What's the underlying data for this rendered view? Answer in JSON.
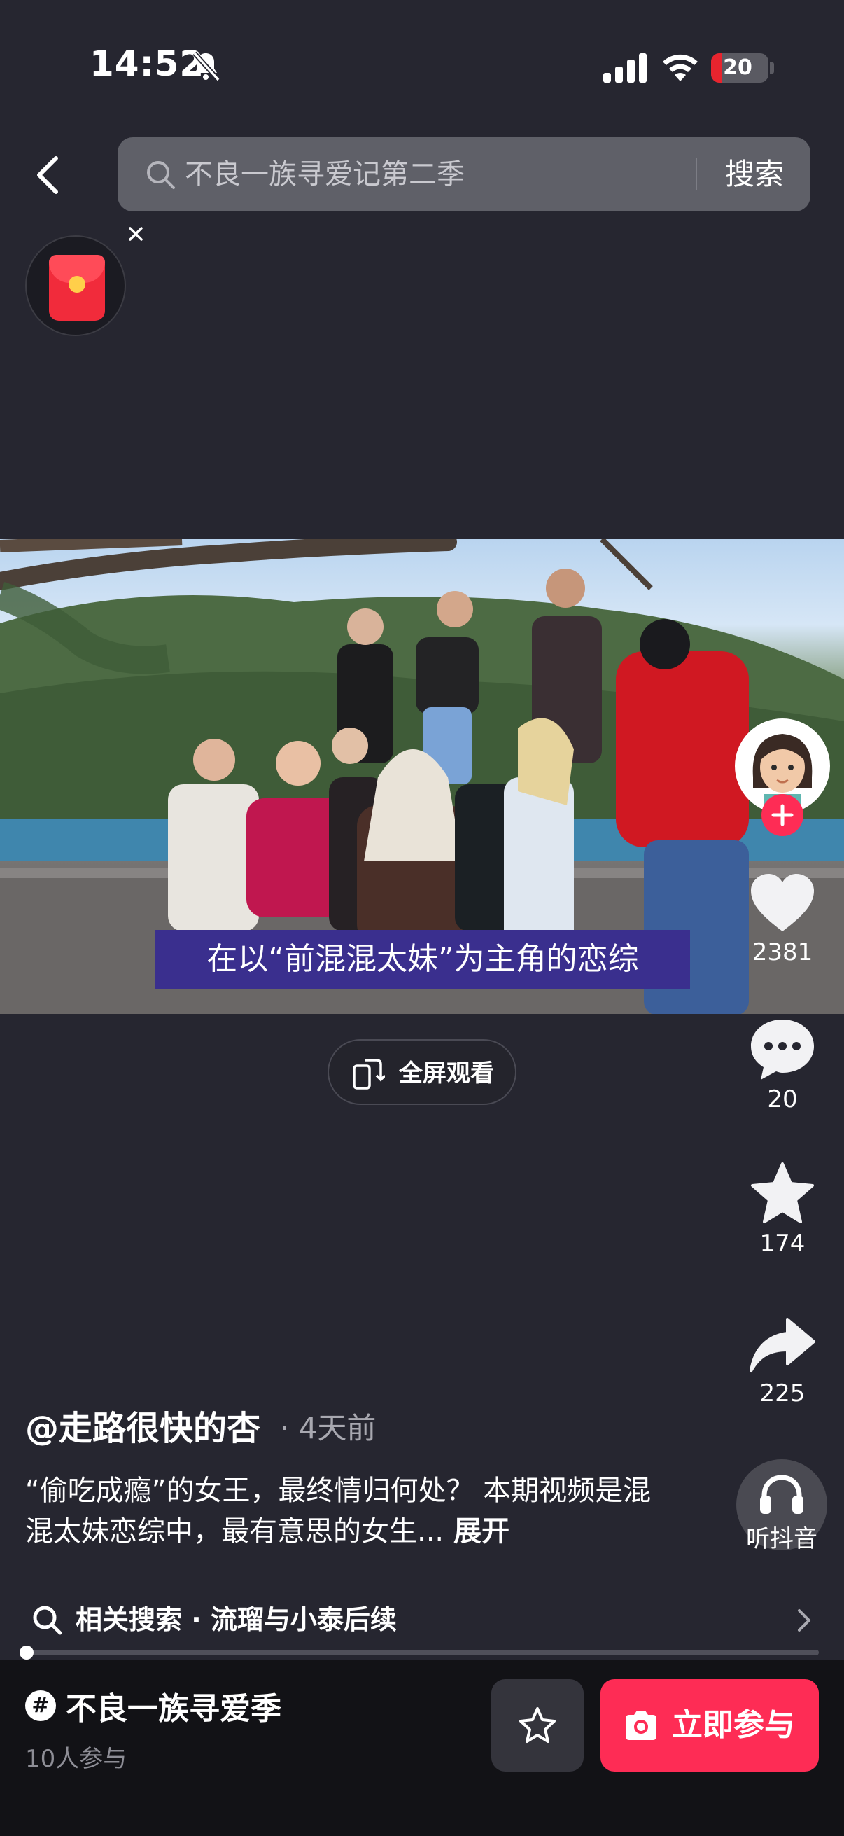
{
  "status_bar": {
    "time": "14:52",
    "battery": "20",
    "battery_level": 0.2,
    "icons": [
      "bell-slash-icon",
      "cellular-signal-icon",
      "wifi-icon",
      "battery-icon"
    ]
  },
  "header": {
    "back_icon": "chevron-left-icon",
    "search_query": "不良一族寻爱记第二季",
    "search_button": "搜索"
  },
  "red_packet": {
    "icon": "red-envelope-icon",
    "close_icon": "close-icon"
  },
  "video": {
    "subtitle": "在以“前混混太妹”为主角的恋综"
  },
  "fullscreen": {
    "label": "全屏观看",
    "icon": "rotate-screen-icon"
  },
  "actions": {
    "likes": "2381",
    "comments": "20",
    "favorites": "174",
    "shares": "225",
    "listen": "听抖音"
  },
  "post": {
    "author": "@走路很快的杏",
    "time_ago": "· 4天前",
    "caption": "“偷吃成瘾”的女王，最终情归何处？ 本期视频是混混太妹恋综中，最有意思的女生...",
    "expand": "展开"
  },
  "related": {
    "text": "相关搜索 · 流瑠与小泰后续"
  },
  "progress": {
    "fraction": 0.01
  },
  "bottom": {
    "hashtag_symbol": "#",
    "topic": "不良一族寻爱季",
    "participants": "10人参与",
    "join_label": "立即参与"
  },
  "colors": {
    "background": "#262630",
    "accent": "#fe2c55",
    "subtitle_bg": "#3a2f8e"
  }
}
